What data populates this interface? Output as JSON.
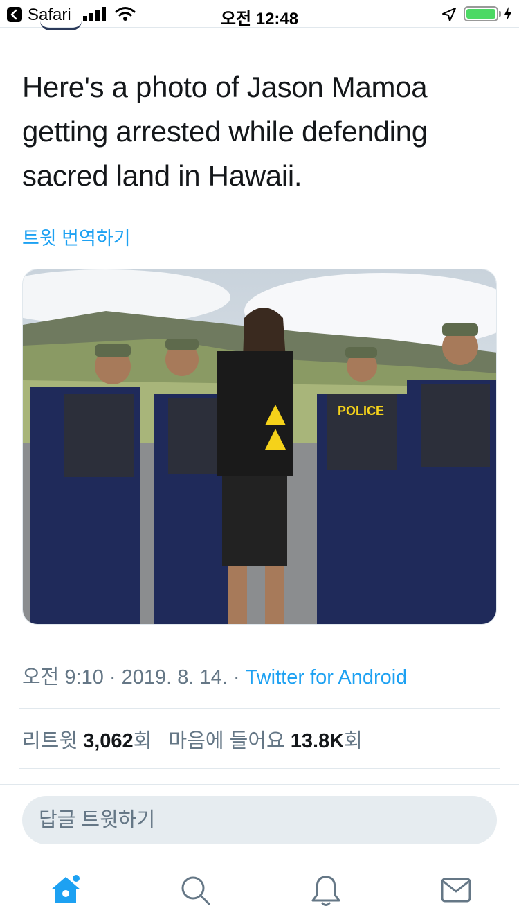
{
  "status_bar": {
    "back_app": "Safari",
    "time": "오전 12:48",
    "colors": {
      "battery": "#4cd964"
    }
  },
  "tweet": {
    "text": "Here's a photo of Jason Mamoa getting arrested while defending sacred land in Hawaii.",
    "translate_label": "트윗 번역하기",
    "media": {
      "description_icon": "photo",
      "police_text": "POLICE"
    },
    "timestamp": "오전 9:10 · 2019. 8. 14. · ",
    "source": "Twitter for Android",
    "retweets_label": "리트윗 ",
    "retweets_count": "3,062",
    "retweets_suffix": "회",
    "likes_label": "마음에 들어요 ",
    "likes_count": "13.8K",
    "likes_suffix": "회"
  },
  "reply": {
    "placeholder": "답글 트윗하기"
  },
  "tabbar": {
    "items": [
      {
        "name": "home-icon",
        "active": true
      },
      {
        "name": "search-icon",
        "active": false
      },
      {
        "name": "notifications-icon",
        "active": false
      },
      {
        "name": "messages-icon",
        "active": false
      }
    ],
    "colors": {
      "active": "#1da1f2",
      "inactive": "#657786"
    }
  }
}
